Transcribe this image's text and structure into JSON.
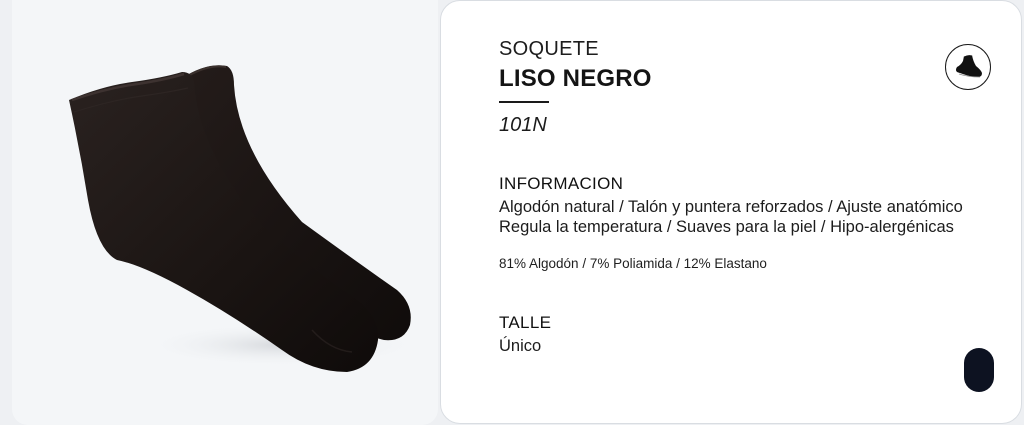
{
  "product": {
    "category": "SOQUETE",
    "name": "LISO NEGRO",
    "code": "101N",
    "image_alt": "black-ankle-socks",
    "badge_icon": "sock-icon"
  },
  "info": {
    "heading": "INFORMACION",
    "line1": "Algodón natural / Talón y puntera reforzados / Ajuste anatómico",
    "line2": "Regula la temperatura / Suaves para la piel / Hipo-alergénicas",
    "composition": "81% Algodón / 7% Poliamida / 12% Elastano"
  },
  "size": {
    "heading": "TALLE",
    "value": "Único"
  },
  "colors": {
    "card_bg": "#ffffff",
    "page_bg": "#eef0f3",
    "sock": "#1a1412",
    "accent_dark": "#0d1221"
  }
}
